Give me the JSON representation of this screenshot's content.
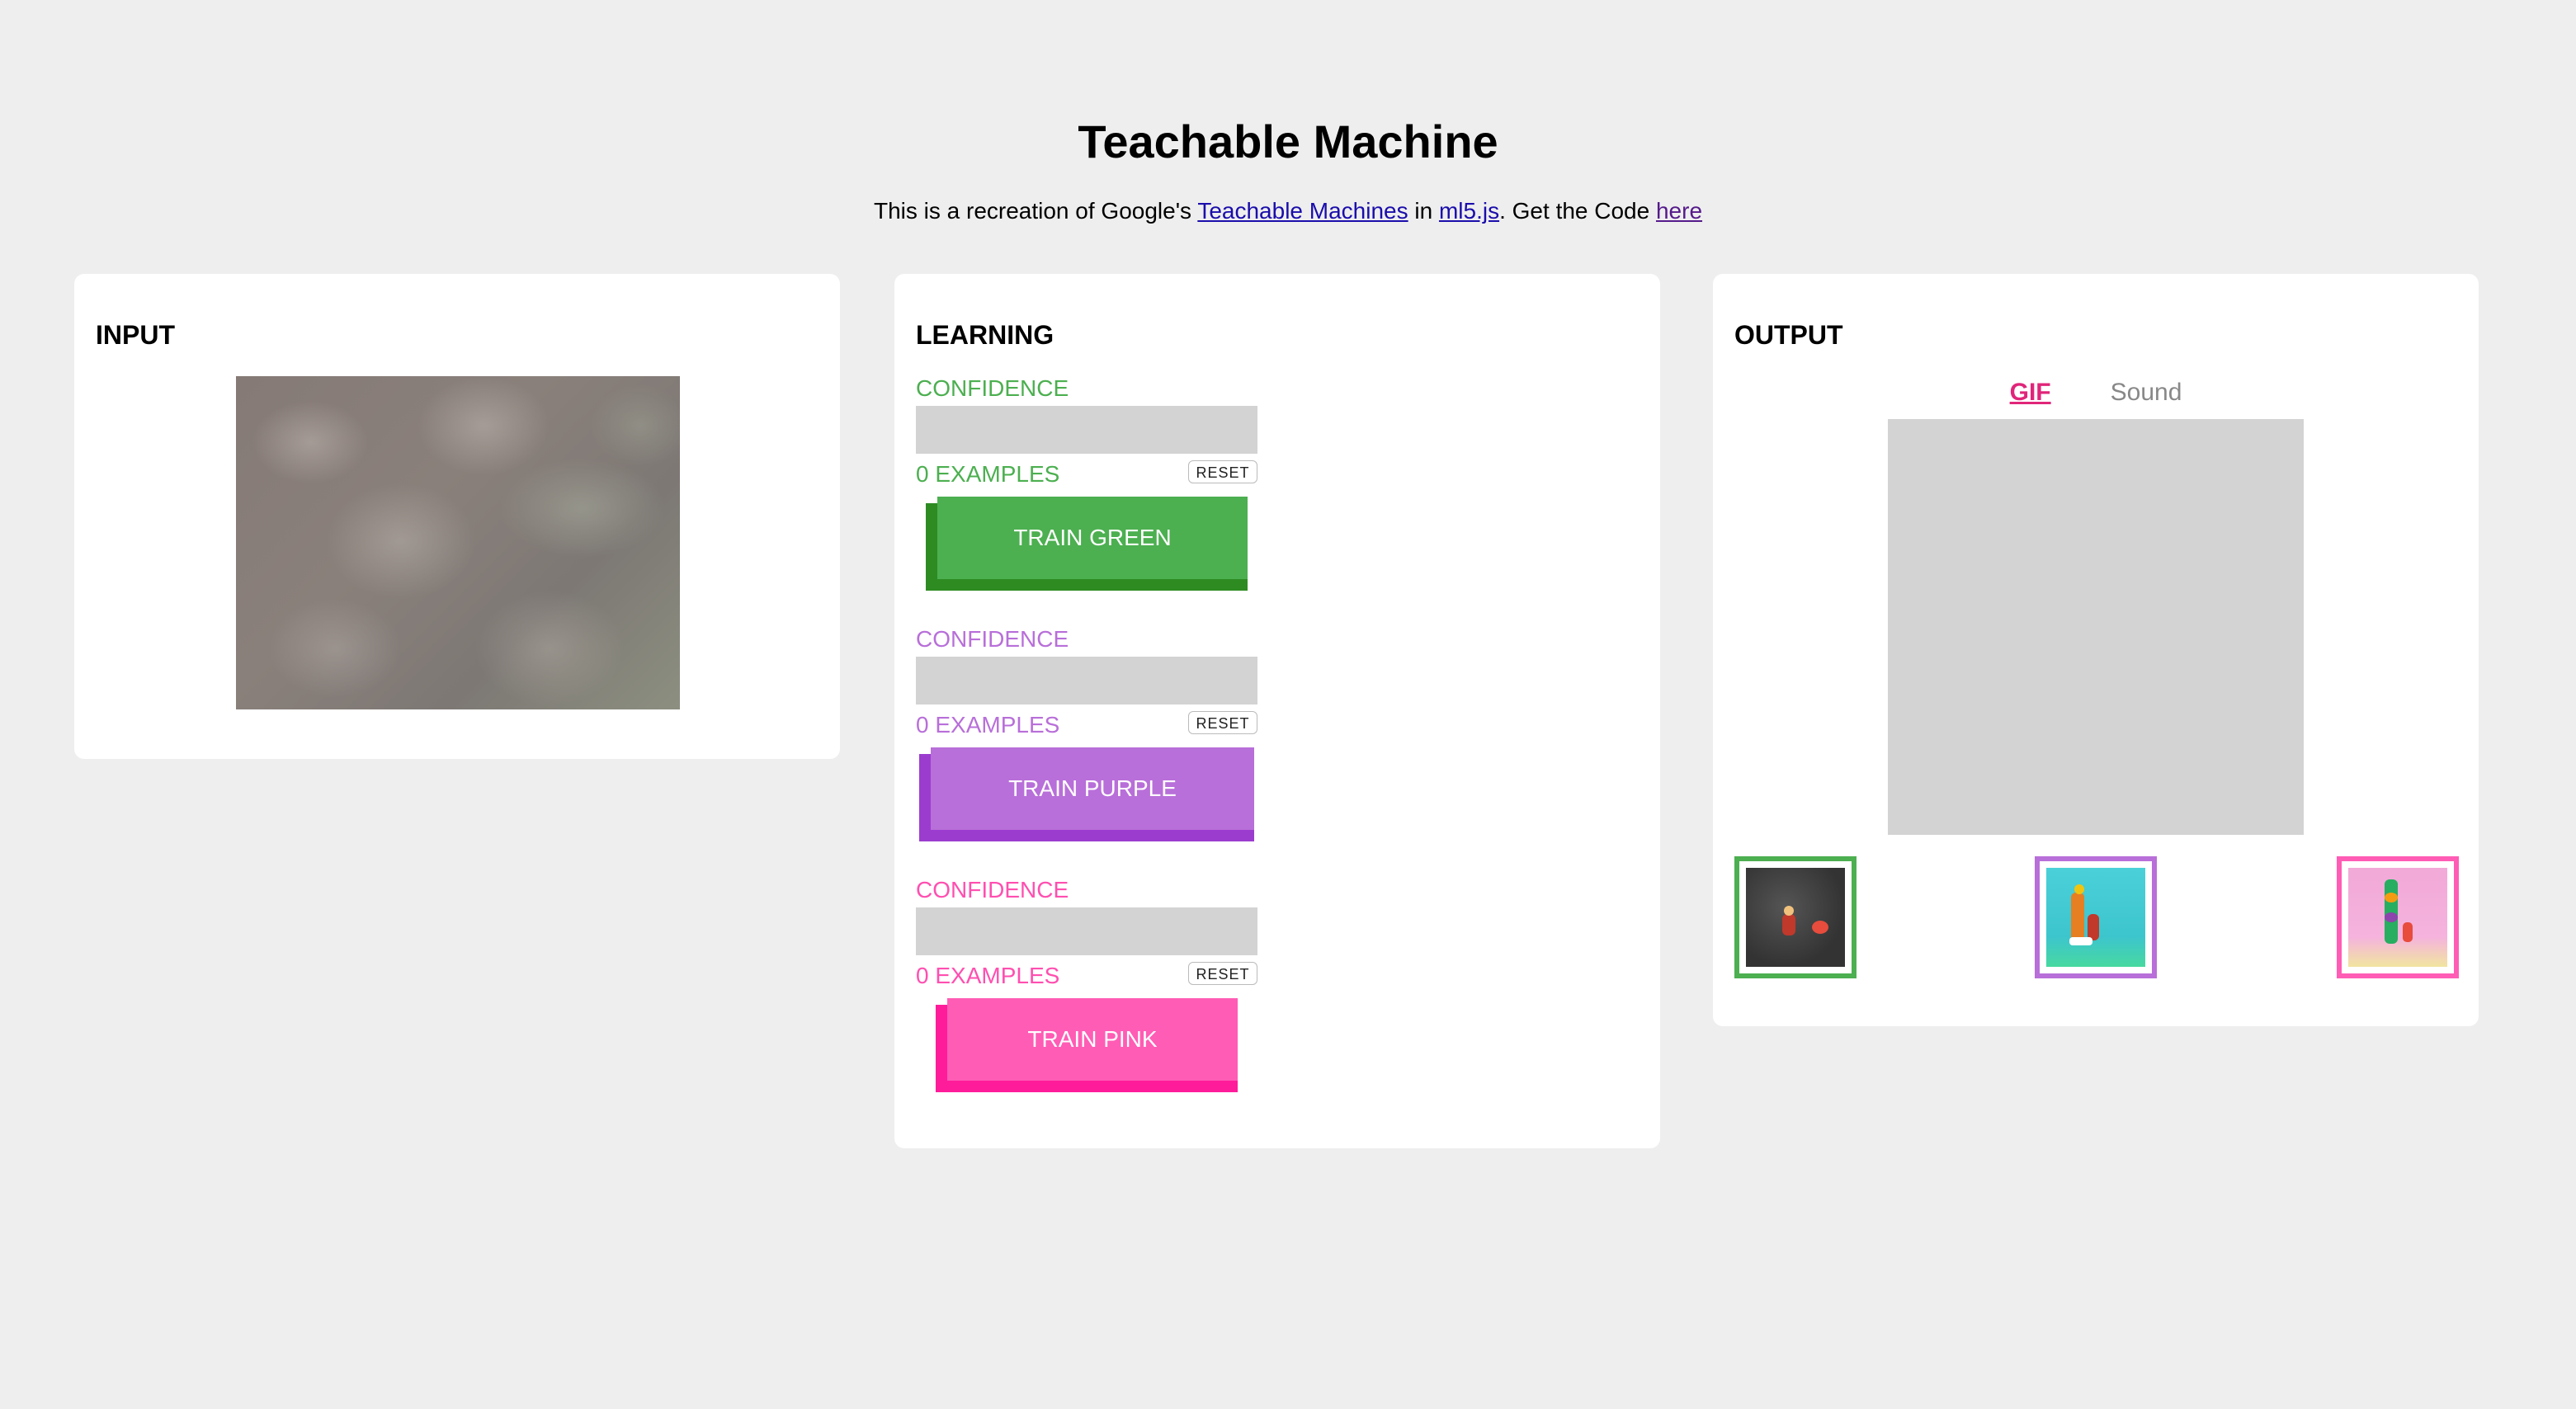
{
  "header": {
    "title": "Teachable Machine",
    "subtitle_prefix": "This is a recreation of Google's ",
    "link1": "Teachable Machines",
    "subtitle_mid1": " in ",
    "link2": "ml5.js",
    "subtitle_mid2": ". Get the Code ",
    "link3": "here"
  },
  "input": {
    "title": "INPUT"
  },
  "learning": {
    "title": "LEARNING",
    "classes": [
      {
        "confidence_label": "CONFIDENCE",
        "confidence": 0,
        "examples": "0 EXAMPLES",
        "reset": "RESET",
        "train": "TRAIN GREEN",
        "color": "#4caf50"
      },
      {
        "confidence_label": "CONFIDENCE",
        "confidence": 0,
        "examples": "0 EXAMPLES",
        "reset": "RESET",
        "train": "TRAIN PURPLE",
        "color": "#b86fd9"
      },
      {
        "confidence_label": "CONFIDENCE",
        "confidence": 0,
        "examples": "0 EXAMPLES",
        "reset": "RESET",
        "train": "TRAIN PINK",
        "color": "#ff5cb5"
      }
    ]
  },
  "output": {
    "title": "OUTPUT",
    "tabs": [
      "GIF",
      "Sound"
    ],
    "active_tab": "GIF"
  }
}
